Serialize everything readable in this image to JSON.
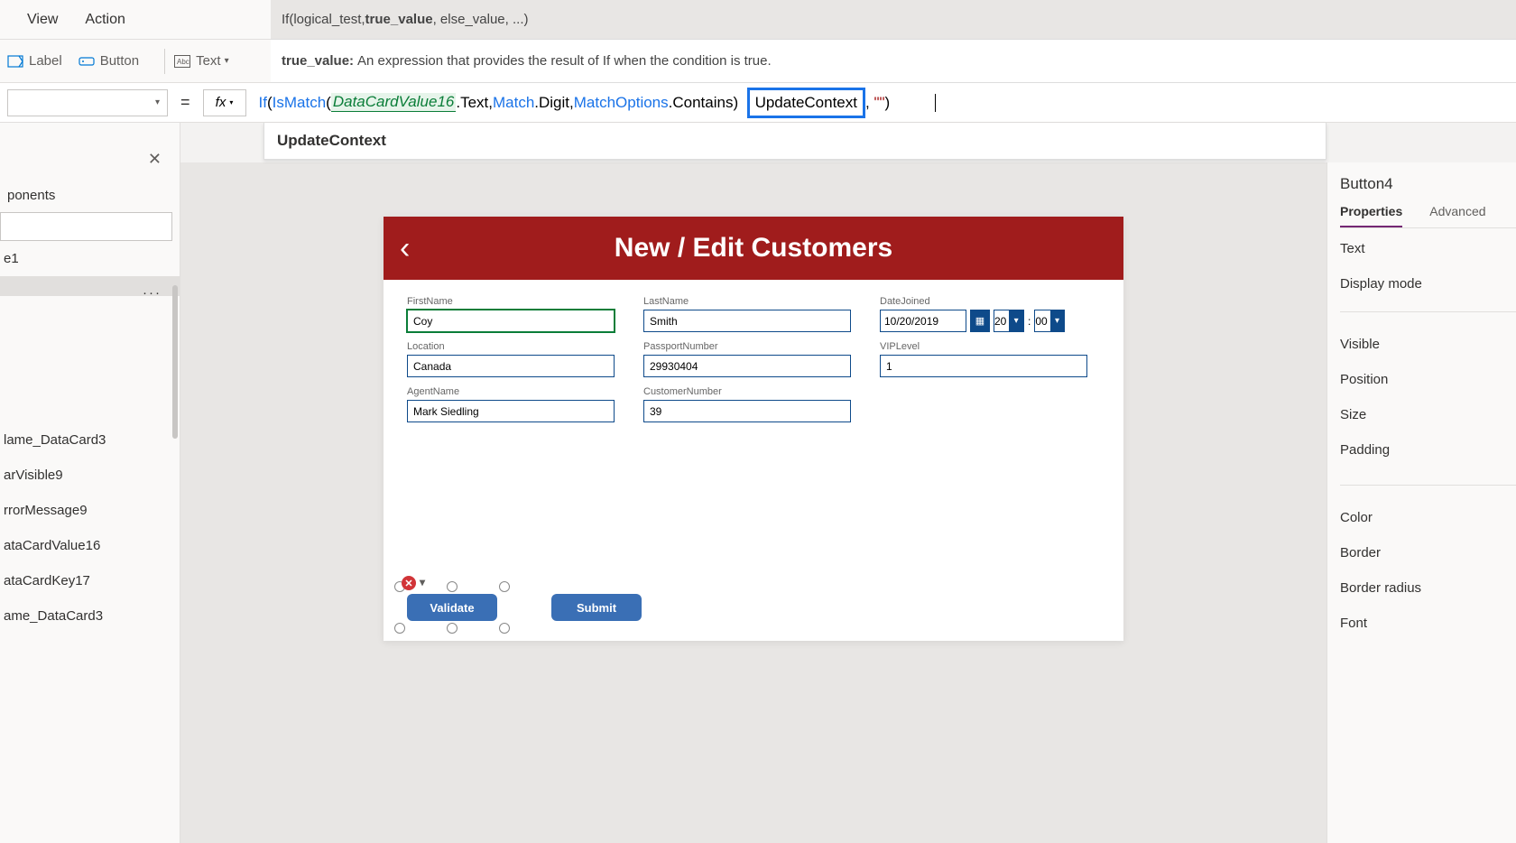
{
  "menu": {
    "view": "View",
    "action": "Action"
  },
  "hint": {
    "prefix": "If(logical_test, ",
    "bold": "true_value",
    "suffix": ", else_value, ...)"
  },
  "toolbar": {
    "label": "Label",
    "button": "Button",
    "text": "Text"
  },
  "desc": {
    "label": "true_value:",
    "text": "An expression that provides the result of If when the condition is true."
  },
  "formula": {
    "if": "If",
    "ismatch": "IsMatch",
    "ref": "DataCardValue16",
    "dot_text": ".Text, ",
    "match": "Match",
    "dot_digit": ".Digit, ",
    "matchoptions": "MatchOptions",
    "dot_contains": ".Contains)",
    "highlighted": "UpdateContext",
    "tail_comma": ",",
    "tail_str": "\"\"",
    "tail_paren": ")"
  },
  "intellisense": {
    "item": "UpdateContext"
  },
  "left": {
    "section": "ponents",
    "item_e1": "e1",
    "items": [
      "lame_DataCard3",
      "arVisible9",
      "rrorMessage9",
      "ataCardValue16",
      "ataCardKey17",
      "ame_DataCard3"
    ]
  },
  "app": {
    "title": "New / Edit Customers",
    "firstname_label": "FirstName",
    "firstname": "Coy",
    "lastname_label": "LastName",
    "lastname": "Smith",
    "datejoined_label": "DateJoined",
    "datejoined": "10/20/2019",
    "hour": "20",
    "minute": "00",
    "location_label": "Location",
    "location": "Canada",
    "passport_label": "PassportNumber",
    "passport": "29930404",
    "vip_label": "VIPLevel",
    "vip": "1",
    "agent_label": "AgentName",
    "agent": "Mark Siedling",
    "custnum_label": "CustomerNumber",
    "custnum": "39",
    "validate": "Validate",
    "submit": "Submit"
  },
  "right": {
    "name": "Button4",
    "tab_props": "Properties",
    "tab_adv": "Advanced",
    "rows": {
      "text": "Text",
      "display": "Display mode",
      "visible": "Visible",
      "position": "Position",
      "size": "Size",
      "padding": "Padding",
      "color": "Color",
      "border": "Border",
      "radius": "Border radius",
      "font": "Font"
    }
  }
}
